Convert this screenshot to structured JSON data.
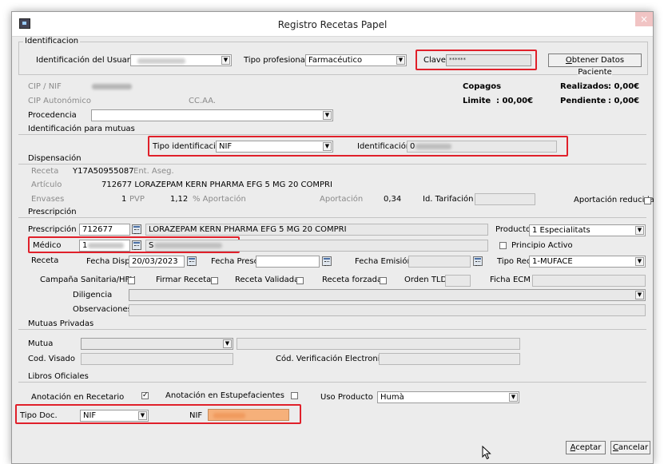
{
  "window": {
    "title": "Registro Recetas Papel",
    "close_glyph": "×"
  },
  "identificacion": {
    "group_title": "Identificacion",
    "usuario_label": "Identificación del Usuario",
    "tipo_profesional_label": "Tipo profesional",
    "tipo_profesional_value": "Farmacéutico",
    "clave_label": "Clave",
    "clave_value": "******",
    "obtener_button": "Obtener Datos Paciente",
    "obtener_button_mnemonic": "O"
  },
  "paciente": {
    "cip_nif_label": "CIP / NIF",
    "cip_autonomico_label": "CIP Autonómico",
    "ccaa_label": "CC.AA.",
    "procedencia_label": "Procedencia",
    "copagos_label": "Copagos",
    "limite_label": "Limite",
    "limite_value": ":  00,00€",
    "realizados_label": "Realizados",
    "realizados_value": ":  0,00€",
    "pendiente_label": "Pendiente",
    "pendiente_value": ":  0,00€"
  },
  "mutuas_ident": {
    "section_title": "Identificación para mutuas",
    "tipo_identificacion_label": "Tipo identificación",
    "tipo_identificacion_value": "NIF",
    "identificacion_label": "Identificación",
    "identificacion_value": "0"
  },
  "dispensacion": {
    "section_title": "Dispensación",
    "receta_label": "Receta",
    "receta_value": "Y17A50955087",
    "ent_aseg_label": "Ent. Aseg.",
    "articulo_label": "Artículo",
    "articulo_value": "712677  LORAZEPAM KERN PHARMA EFG 5 MG 20 COMPRI",
    "envases_label": "Envases",
    "envases_value": "1",
    "pvp_label": "PVP",
    "pvp_value": "1,12",
    "pct_aportacion_label": "% Aportación",
    "aportacion_label": "Aportación",
    "aportacion_value": "0,34",
    "id_tarifacion_label": "Id. Tarifación",
    "aportacion_reducida_label": "Aportación reducida"
  },
  "prescripcion": {
    "section_title": "Prescripción",
    "prescripcion_label": "Prescripción",
    "prescripcion_code": "712677",
    "prescripcion_desc": "LORAZEPAM KERN PHARMA EFG 5 MG 20 COMPRI",
    "producto_label": "Producto",
    "producto_value": "1 Especialitats",
    "medico_label": "Médico",
    "medico_code": "1",
    "medico_name": "S",
    "principio_activo_label": "Principio Activo",
    "receta_label": "Receta",
    "fecha_disp_label": "Fecha Disp",
    "fecha_disp_value": "20/03/2023",
    "fecha_presc_label": "Fecha Presc",
    "fecha_emision_label": "Fecha Emisión",
    "tipo_rec_label": "Tipo Rec",
    "tipo_rec_value": "1-MUFACE",
    "campana_label": "Campaña Sanitaria/HFH",
    "firmar_label": "Firmar Receta",
    "validada_label": "Receta Validada",
    "forzada_label": "Receta forzada",
    "orden_tld_label": "Orden TLD",
    "ficha_ecm_label": "Ficha ECM",
    "diligencia_label": "Diligencia",
    "observaciones_label": "Observaciones"
  },
  "mutuas_privadas": {
    "section_title": "Mutuas Privadas",
    "mutua_label": "Mutua",
    "cod_visado_label": "Cod. Visado",
    "cod_verificacion_label": "Cód. Verificación Electronico"
  },
  "libros": {
    "section_title": "Libros Oficiales",
    "anotacion_recetario_label": "Anotación en Recetario",
    "anotacion_estupefacientes_label": "Anotación en Estupefacientes",
    "uso_producto_label": "Uso Producto",
    "uso_producto_value": "Humà",
    "tipo_doc_label": "Tipo Doc.",
    "tipo_doc_value": "NIF",
    "nif_label": "NIF"
  },
  "actions": {
    "aceptar": "Aceptar",
    "aceptar_mnemonic": "A",
    "cancelar": "Cancelar",
    "cancelar_mnemonic": "C"
  },
  "colors": {
    "highlight": "#e0202a",
    "nif_fill": "#f6b07a"
  }
}
